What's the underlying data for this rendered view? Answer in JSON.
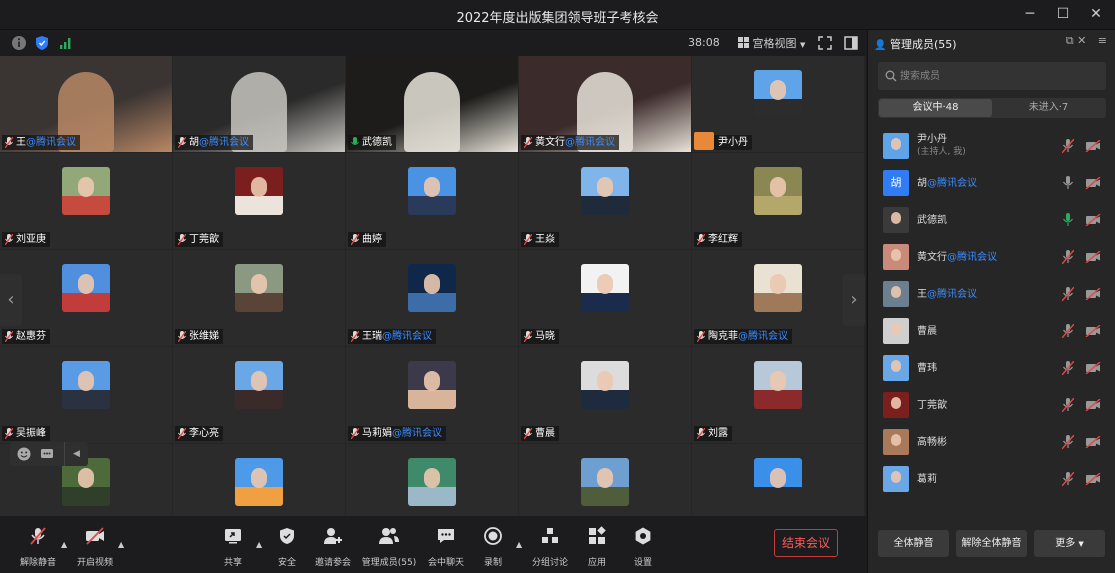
{
  "window": {
    "title": "2022年度出版集团领导班子考核会"
  },
  "topbar": {
    "duration": "38:08",
    "view_mode": "宫格视图"
  },
  "tiles": [
    {
      "name": "王",
      "suffix": "@腾讯会议",
      "style": "video",
      "colors": [
        "#3a3432",
        "#b98865"
      ]
    },
    {
      "name": "胡",
      "suffix": "@腾讯会议",
      "style": "video",
      "colors": [
        "#2a2a2a",
        "#c7c5c0"
      ]
    },
    {
      "name": "武德凯",
      "suffix": "",
      "style": "video",
      "colors": [
        "#1d1c1a",
        "#e8e4da"
      ],
      "active": true
    },
    {
      "name": "黄文行",
      "suffix": "@腾讯会议",
      "style": "video",
      "colors": [
        "#3b2b2b",
        "#e9e3d9"
      ]
    },
    {
      "name": "尹小丹",
      "suffix": "",
      "style": "portrait",
      "colors": [
        "#5fa3e8",
        "#2c2c2c"
      ],
      "host": true
    },
    {
      "name": "刘亚庚",
      "suffix": "",
      "style": "portrait",
      "colors": [
        "#93a878",
        "#c64b3f"
      ]
    },
    {
      "name": "丁莞歆",
      "suffix": "",
      "style": "portrait",
      "colors": [
        "#7a1e1e",
        "#ede3dd"
      ]
    },
    {
      "name": "曲婷",
      "suffix": "",
      "style": "portrait",
      "colors": [
        "#4a92e3",
        "#2a3a5a"
      ]
    },
    {
      "name": "王焱",
      "suffix": "",
      "style": "portrait",
      "colors": [
        "#7fb5ea",
        "#1f2a3a"
      ]
    },
    {
      "name": "李红辉",
      "suffix": "",
      "style": "portrait",
      "colors": [
        "#8b8753",
        "#b3a86a"
      ]
    },
    {
      "name": "赵惠芬",
      "suffix": "",
      "style": "portrait",
      "colors": [
        "#4f8fdd",
        "#c33c3c"
      ]
    },
    {
      "name": "张维娣",
      "suffix": "",
      "style": "portrait",
      "colors": [
        "#8c9982",
        "#5a4437"
      ]
    },
    {
      "name": "王瑞",
      "suffix": "@腾讯会议",
      "style": "portrait",
      "colors": [
        "#0f2748",
        "#3c6da8"
      ]
    },
    {
      "name": "马晓",
      "suffix": "",
      "style": "portrait",
      "colors": [
        "#f2f2f2",
        "#1a2b4c"
      ]
    },
    {
      "name": "陶克菲",
      "suffix": "@腾讯会议",
      "style": "portrait",
      "colors": [
        "#e9e2d2",
        "#9e7a5a"
      ]
    },
    {
      "name": "吴振峰",
      "suffix": "",
      "style": "portrait",
      "colors": [
        "#5a9be6",
        "#2a3140"
      ]
    },
    {
      "name": "李心亮",
      "suffix": "",
      "style": "portrait",
      "colors": [
        "#6aa7e6",
        "#3a2a2a"
      ]
    },
    {
      "name": "马莉娟",
      "suffix": "@腾讯会议",
      "style": "portrait",
      "colors": [
        "#3c3a4a",
        "#d8b49a"
      ]
    },
    {
      "name": "曹晨",
      "suffix": "",
      "style": "portrait",
      "colors": [
        "#dcdcdc",
        "#1e2a3e"
      ]
    },
    {
      "name": "刘露",
      "suffix": "",
      "style": "portrait",
      "colors": [
        "#b7c9d8",
        "#8a2a2a"
      ]
    },
    {
      "name": "",
      "suffix": "",
      "style": "portrait",
      "colors": [
        "#4c6a3a",
        "#2f3f2a"
      ]
    },
    {
      "name": "",
      "suffix": "",
      "style": "portrait",
      "colors": [
        "#4c9ae8",
        "#f0a040"
      ]
    },
    {
      "name": "",
      "suffix": "",
      "style": "portrait",
      "colors": [
        "#3f8a6a",
        "#9ab8c8"
      ]
    },
    {
      "name": "",
      "suffix": "",
      "style": "portrait",
      "colors": [
        "#6f9ed1",
        "#4f5d3a"
      ]
    },
    {
      "name": "",
      "suffix": "",
      "style": "portrait",
      "colors": [
        "#3a8fe8",
        "#2b2b2b"
      ]
    }
  ],
  "bottombar": {
    "unmute": "解除静音",
    "start_video": "开启视频",
    "share": "共享",
    "security": "安全",
    "invite": "邀请参会",
    "manage_members": "管理成员(55)",
    "chat": "会中聊天",
    "record": "录制",
    "breakout": "分组讨论",
    "apps": "应用",
    "settings": "设置",
    "end_meeting": "结束会议"
  },
  "panel": {
    "title": "管理成员(55)",
    "search_placeholder": "搜索成员",
    "tab_in": "会议中·48",
    "tab_out": "未进入·7",
    "members": [
      {
        "name": "尹小丹",
        "suffix": "",
        "sub": "(主持人, 我)",
        "color": "#5fa3e8",
        "mic": "muted",
        "letter": ""
      },
      {
        "name": "胡",
        "suffix": "@腾讯会议",
        "sub": "",
        "color": "#2f7cf6",
        "mic": "on",
        "letter": "胡"
      },
      {
        "name": "武德凯",
        "suffix": "",
        "sub": "",
        "color": "#3a3a3a",
        "mic": "active",
        "letter": ""
      },
      {
        "name": "黄文行",
        "suffix": "@腾讯会议",
        "sub": "",
        "color": "#c98a7a",
        "mic": "muted",
        "letter": ""
      },
      {
        "name": "王",
        "suffix": "@腾讯会议",
        "sub": "",
        "color": "#6b7f8f",
        "mic": "muted",
        "letter": ""
      },
      {
        "name": "曹晨",
        "suffix": "",
        "sub": "",
        "color": "#cfcfcf",
        "mic": "muted",
        "letter": ""
      },
      {
        "name": "曹玮",
        "suffix": "",
        "sub": "",
        "color": "#6aa7e6",
        "mic": "muted",
        "letter": ""
      },
      {
        "name": "丁莞歆",
        "suffix": "",
        "sub": "",
        "color": "#7a1e1e",
        "mic": "muted",
        "letter": ""
      },
      {
        "name": "高畅彬",
        "suffix": "",
        "sub": "",
        "color": "#a87a5a",
        "mic": "muted",
        "letter": ""
      },
      {
        "name": "葛莉",
        "suffix": "",
        "sub": "",
        "color": "#6aa7e6",
        "mic": "muted",
        "letter": ""
      }
    ],
    "mute_all": "全体静音",
    "unmute_all": "解除全体静音",
    "more": "更多"
  }
}
